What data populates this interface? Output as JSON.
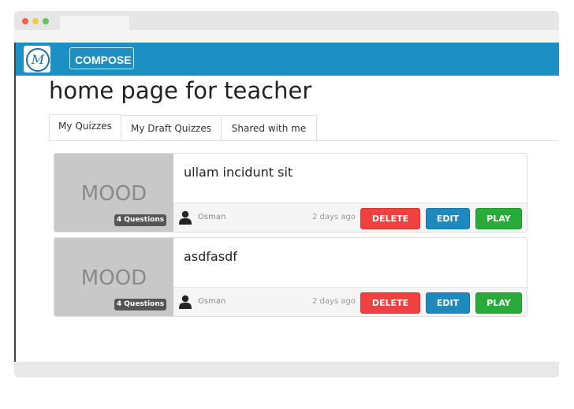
{
  "navbar": {
    "compose_label": "COMPOSE",
    "logo_letter": "M"
  },
  "page_title": "home page for teacher",
  "tabs": [
    {
      "label": "My Quizzes",
      "active": true
    },
    {
      "label": "My Draft Quizzes",
      "active": false
    },
    {
      "label": "Shared with me",
      "active": false
    }
  ],
  "quizzes": [
    {
      "thumb_text": "MOOD",
      "badge": "4 Questions",
      "title": "ullam incidunt sit",
      "author": "Osman",
      "time": "2 days ago",
      "delete_label": "DELETE",
      "edit_label": "EDIT",
      "play_label": "PLAY"
    },
    {
      "thumb_text": "MOOD",
      "badge": "4 Questions",
      "title": "asdfasdf",
      "author": "Osman",
      "time": "2 days ago",
      "delete_label": "DELETE",
      "edit_label": "EDIT",
      "play_label": "PLAY"
    }
  ],
  "colors": {
    "navbar": "#1d90c3",
    "delete": "#f04040",
    "edit": "#1f89bd",
    "play": "#29ab3a"
  },
  "icons": {
    "user": "user-icon"
  }
}
